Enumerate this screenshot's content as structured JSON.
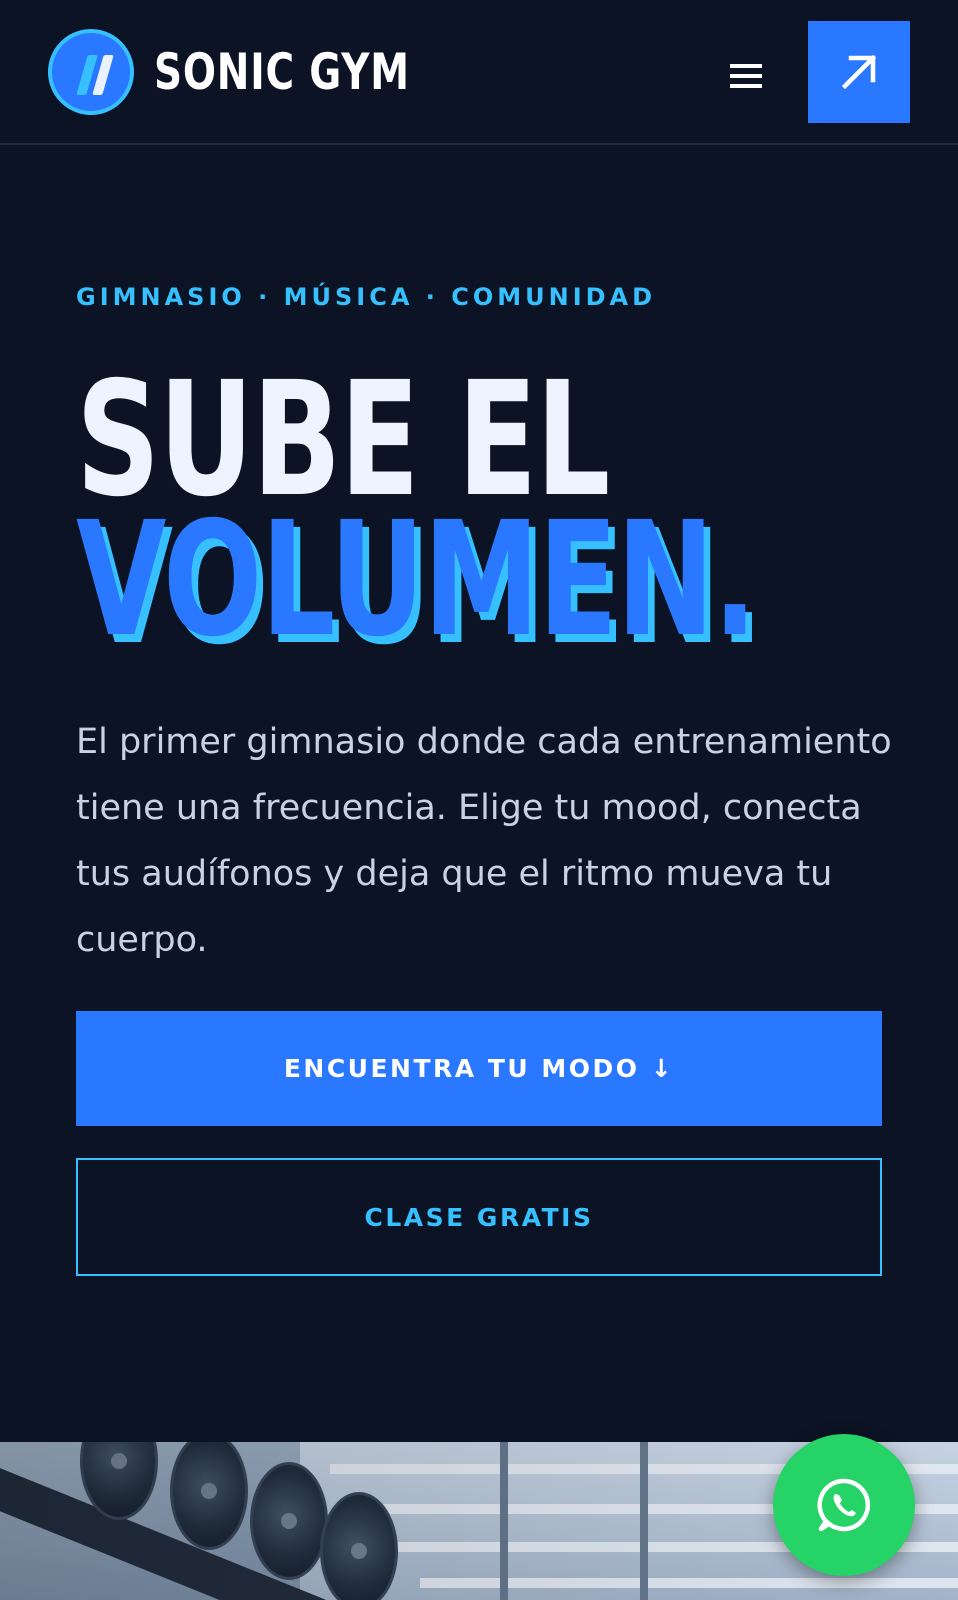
{
  "header": {
    "brand": "SONIC GYM",
    "menu_icon": "hamburger-menu-icon",
    "cta_icon": "arrow-up-right-icon"
  },
  "hero": {
    "eyebrow": "GIMNASIO · MÚSICA · COMUNIDAD",
    "headline_line1": "SUBE EL",
    "headline_line2": "VOLUMEN.",
    "lead": "El primer gimnasio donde cada entrenamiento tiene una frecuencia. Elige tu mood, conecta tus audífonos y deja que el ritmo mueva tu cuerpo.",
    "primary_button": "ENCUENTRA TU MODO ↓",
    "secondary_button": "CLASE GRATIS"
  },
  "floating": {
    "whatsapp_icon": "whatsapp-icon"
  },
  "colors": {
    "background": "#0b1324",
    "accent_blue": "#2a78ff",
    "accent_cyan": "#36c0ff",
    "whatsapp_green": "#25d366",
    "headline_white": "#eef4ff",
    "body_text": "#c9d2e2"
  }
}
